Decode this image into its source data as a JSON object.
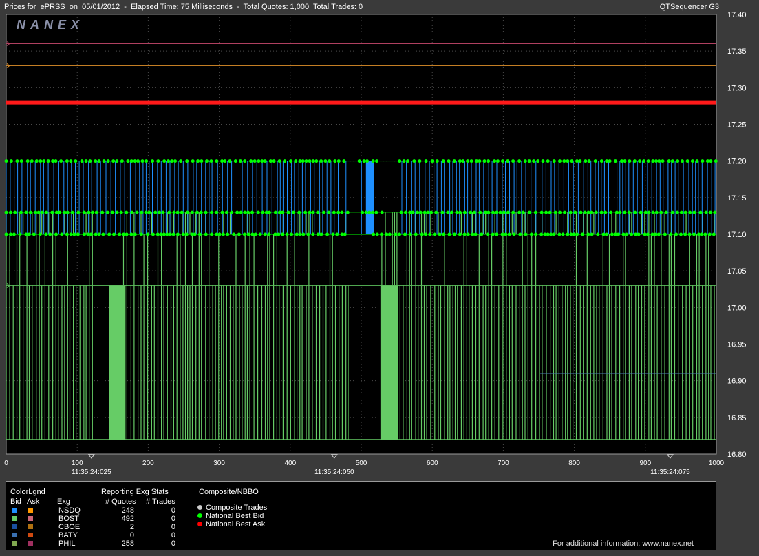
{
  "title": {
    "left": "Prices for  ePRSS  on  05/01/2012  -  Elapsed Time: 75 Milliseconds  -  Total Quotes: 1,000  Total Trades: 0",
    "right": "QTSequencer G3"
  },
  "watermark": "NANEX",
  "chart_data": {
    "type": "line",
    "xlim": [
      0,
      1000
    ],
    "ylim": [
      16.8,
      17.4
    ],
    "x_ticks": [
      0,
      100,
      200,
      300,
      400,
      500,
      600,
      700,
      800,
      900,
      1000
    ],
    "y_ticks": [
      "17.40",
      "17.35",
      "17.30",
      "17.25",
      "17.20",
      "17.15",
      "17.10",
      "17.05",
      "17.00",
      "16.95",
      "16.90",
      "16.85",
      "16.80"
    ],
    "time_markers": [
      {
        "x": 120,
        "label": "11:35:24:025"
      },
      {
        "x": 462,
        "label": "11:35:24:050"
      },
      {
        "x": 935,
        "label": "11:35:24:075"
      }
    ],
    "grid": true,
    "reference_lines": [
      {
        "y": 17.36,
        "color": "#b04060"
      },
      {
        "y": 17.33,
        "color": "#e0902a"
      },
      {
        "y": 17.28,
        "color": "#ff1a1a"
      },
      {
        "y": 17.03,
        "color": "#5cbf5c"
      },
      {
        "y": 16.91,
        "color": "#4a7fb0"
      }
    ],
    "series": [
      {
        "name": "NSDQ Bid",
        "values_range": [
          17.1,
          17.2
        ],
        "color": "#1e90ff"
      },
      {
        "name": "BOST Bid",
        "values_range": [
          16.82,
          17.13
        ],
        "color": "#66cc66"
      },
      {
        "name": "National Best Bid",
        "levels": [
          17.2,
          17.13,
          17.1
        ],
        "color": "#00ff00"
      },
      {
        "name": "National Best Ask",
        "value": 17.28,
        "color": "#ff0000"
      }
    ]
  },
  "legend": {
    "colorlgnd_title": "ColorLgnd",
    "stats_title": "Reporting Exg Stats",
    "composite_title": "Composite/NBBO",
    "headers": {
      "bid": "Bid",
      "ask": "Ask",
      "exg": "Exg",
      "quotes": "# Quotes",
      "trades": "# Trades"
    },
    "rows": [
      {
        "exg": "NSDQ",
        "quotes": "248",
        "trades": "0",
        "bid_color": "#1e90ff",
        "ask_color": "#ff9900"
      },
      {
        "exg": "BOST",
        "quotes": "492",
        "trades": "0",
        "bid_color": "#66cc66",
        "ask_color": "#cc6677"
      },
      {
        "exg": "CBOE",
        "quotes": "2",
        "trades": "0",
        "bid_color": "#1a4fa0",
        "ask_color": "#b07010"
      },
      {
        "exg": "BATY",
        "quotes": "0",
        "trades": "0",
        "bid_color": "#3a70b0",
        "ask_color": "#d04a10"
      },
      {
        "exg": "PHIL",
        "quotes": "258",
        "trades": "0",
        "bid_color": "#80a850",
        "ask_color": "#a03060"
      }
    ],
    "composite_items": [
      {
        "label": "Composite Trades",
        "color": "#cccccc"
      },
      {
        "label": "National Best Bid",
        "color": "#00ff00"
      },
      {
        "label": "National Best Ask",
        "color": "#ff0000"
      }
    ],
    "footer": "For additional information: www.nanex.net"
  }
}
